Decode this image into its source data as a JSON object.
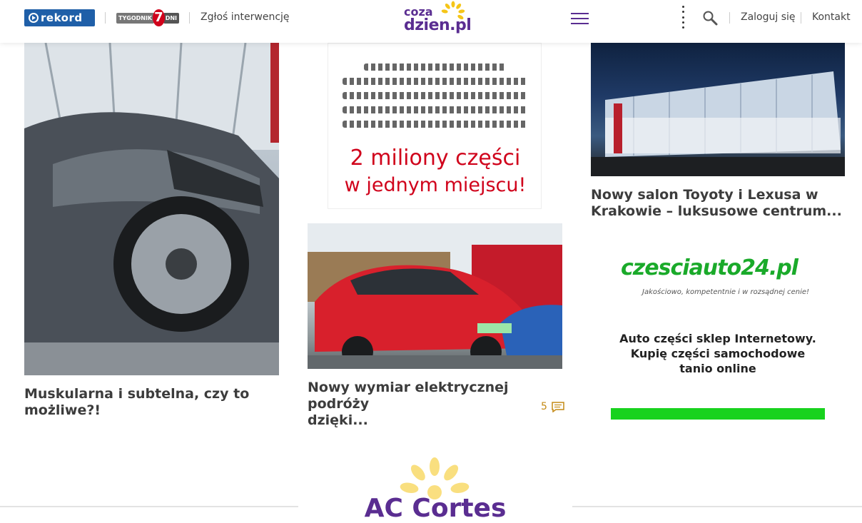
{
  "header": {
    "rekord_logo": "rekord",
    "tygodnik_word": "TYGODNIK",
    "tygodnik_seven": "7",
    "tygodnik_dni": "DNI",
    "intervention_link": "Zgłoś interwencję",
    "site_logo_line1": "coza",
    "site_logo_line2": "dzien.pl",
    "login_link": "Zaloguj się",
    "contact_link": "Kontakt"
  },
  "articles": [
    {
      "title_line1": "Muskularna i subtelna, czy to",
      "title_line2": "możliwe?!"
    },
    {
      "title_line1": "Nowy wymiar elektrycznej podróży",
      "title_line2": "dzięki...",
      "comments": "5"
    },
    {
      "title_line1": "Nowy salon Toyoty i Lexusa w",
      "title_line2": "Krakowie – luksusowe centrum..."
    }
  ],
  "ads": {
    "parts_line1": "2 miliony części",
    "parts_line2": "w jednym miejscu!",
    "czesci_brand": "czesciauto24.pl",
    "czesci_tagline": "Jakościowo, kompetentnie i w rozsądnej cenie!",
    "czesci_desc_line1": "Auto części sklep Internetowy.",
    "czesci_desc_line2": "Kupię części samochodowe",
    "czesci_desc_line3": "tanio online"
  },
  "section": {
    "title": "AC Cortes"
  },
  "colors": {
    "brand_purple": "#5a2d91",
    "sun_yellow": "#f5c518",
    "accent_green": "#18d21e",
    "comment_orange": "#c48a15"
  }
}
